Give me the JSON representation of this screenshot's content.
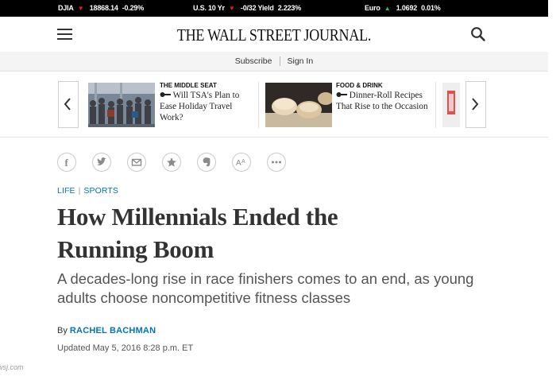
{
  "ticker": [
    {
      "name": "DJIA",
      "direction": "down",
      "value": "18868.14",
      "change": "-0.29%"
    },
    {
      "name": "U.S. 10 Yr",
      "direction": "down",
      "value": "-0/32 Yield",
      "change": "2.223%"
    },
    {
      "name": "Euro",
      "direction": "up",
      "value": "1.0692",
      "change": "0.01%"
    }
  ],
  "header": {
    "logo": "THE WALL STREET JOURNAL.",
    "menu_icon": "hamburger-menu-icon",
    "search_icon": "search-icon"
  },
  "subbar": {
    "subscribe": "Subscribe",
    "signin": "Sign In"
  },
  "carousel": {
    "items": [
      {
        "kicker": "THE MIDDLE SEAT",
        "icon": "key-icon",
        "title": "Will TSA's Plan to Ease Holiday Travel Work?"
      },
      {
        "kicker": "FOOD & DRINK",
        "icon": "key-icon",
        "title": "Dinner-Roll Recipes That Rise to the Occasion"
      }
    ]
  },
  "share_icons": [
    "facebook-icon",
    "twitter-icon",
    "email-icon",
    "star-icon",
    "evernote-icon",
    "text-size-icon",
    "more-icon"
  ],
  "article": {
    "section": "LIFE",
    "subsection": "SPORTS",
    "headline_line1": "How Millennials Ended the",
    "headline_line2": "Running Boom",
    "dek": "A decades-long rise in race finishers comes to an end, as young adults choose noncompetitive fitness classes",
    "by": "By",
    "author": "RACHEL BACHMAN",
    "updated": "Updated May 5, 2016 8:28 p.m. ET"
  },
  "credit": "wsj.com",
  "colors": {
    "ticker_bg": "#000000",
    "down": "#e0202a",
    "up": "#2ebd59",
    "link": "#0274b6"
  }
}
